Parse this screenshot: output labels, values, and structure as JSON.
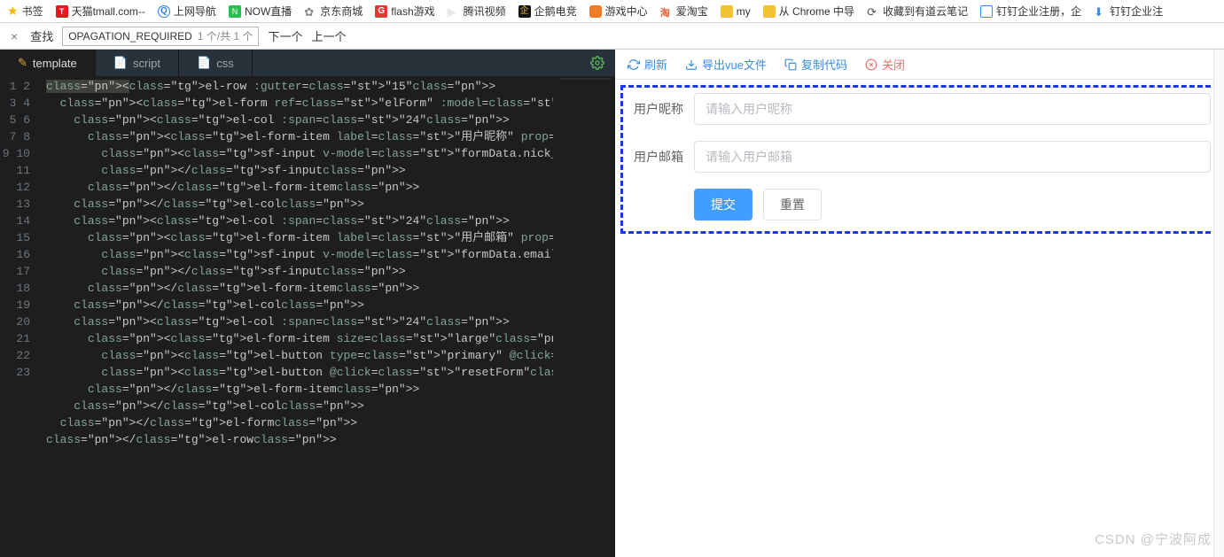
{
  "bookmarks": [
    {
      "icon": "star",
      "label": "书签"
    },
    {
      "icon": "tmall",
      "glyph": "T",
      "label": "天猫tmall.com--"
    },
    {
      "icon": "qb",
      "glyph": "Q",
      "label": "上网导航"
    },
    {
      "icon": "now",
      "glyph": "N",
      "label": "NOW直播"
    },
    {
      "icon": "jd",
      "glyph": "✿",
      "label": "京东商城"
    },
    {
      "icon": "flash",
      "glyph": "G",
      "label": "flash游戏"
    },
    {
      "icon": "tx",
      "glyph": "▶",
      "label": "腾讯视频"
    },
    {
      "icon": "egame",
      "glyph": "企",
      "label": "企鹅电竞"
    },
    {
      "icon": "game",
      "glyph": "",
      "label": "游戏中心"
    },
    {
      "icon": "ai",
      "glyph": "淘",
      "label": "爱淘宝"
    },
    {
      "icon": "folder",
      "glyph": "",
      "label": "my"
    },
    {
      "icon": "folder",
      "glyph": "",
      "label": "从 Chrome 中导"
    },
    {
      "icon": "yd",
      "glyph": "⟳",
      "label": "收藏到有道云笔记"
    },
    {
      "icon": "dd",
      "glyph": "",
      "label": "钉钉企业注册，企"
    },
    {
      "icon": "dd-c",
      "glyph": "⬇",
      "label": "钉钉企业注"
    }
  ],
  "findbar": {
    "close_glyph": "×",
    "label": "查找",
    "query": "OPAGATION_REQUIRED",
    "count": "1 个/共 1 个",
    "prev": "下一个",
    "next": "上一个"
  },
  "tabs": [
    {
      "id": "template",
      "label": "template",
      "active": true
    },
    {
      "id": "script",
      "label": "script",
      "active": false
    },
    {
      "id": "css",
      "label": "css",
      "active": false
    }
  ],
  "code_lines": [
    "<el-row :gutter=\"15\">",
    "  <el-form ref=\"elForm\" :model=\"formData\" :rules=\"rules\" size=\"medium",
    "    <el-col :span=\"24\">",
    "      <el-form-item label=\"用户昵称\" prop=\"nick_name\">",
    "        <sf-input v-model=\"formData.nick_name\" placeholder=\"请输入用户",
    "        </sf-input>",
    "      </el-form-item>",
    "    </el-col>",
    "    <el-col :span=\"24\">",
    "      <el-form-item label=\"用户邮箱\" prop=\"email\">",
    "        <sf-input v-model=\"formData.email\" placeholder=\"请输入用户邮箱",
    "        </sf-input>",
    "      </el-form-item>",
    "    </el-col>",
    "    <el-col :span=\"24\">",
    "      <el-form-item size=\"large\">",
    "        <el-button type=\"primary\" @click=\"submitForm\">提交</el-button",
    "        <el-button @click=\"resetForm\">重置</el-button>",
    "      </el-form-item>",
    "    </el-col>",
    "  </el-form>",
    "</el-row>",
    ""
  ],
  "preview_toolbar": [
    {
      "id": "refresh",
      "icon": "refresh",
      "label": "刷新"
    },
    {
      "id": "export",
      "icon": "download",
      "label": "导出vue文件"
    },
    {
      "id": "copy",
      "icon": "copy",
      "label": "复制代码"
    },
    {
      "id": "close",
      "icon": "close",
      "label": "关闭",
      "cls": "ptb-close"
    }
  ],
  "form": {
    "nick": {
      "label": "用户昵称",
      "placeholder": "请输入用户昵称"
    },
    "email": {
      "label": "用户邮箱",
      "placeholder": "请输入用户邮箱"
    },
    "submit": "提交",
    "reset": "重置"
  },
  "watermark": "CSDN @宁波阿成"
}
